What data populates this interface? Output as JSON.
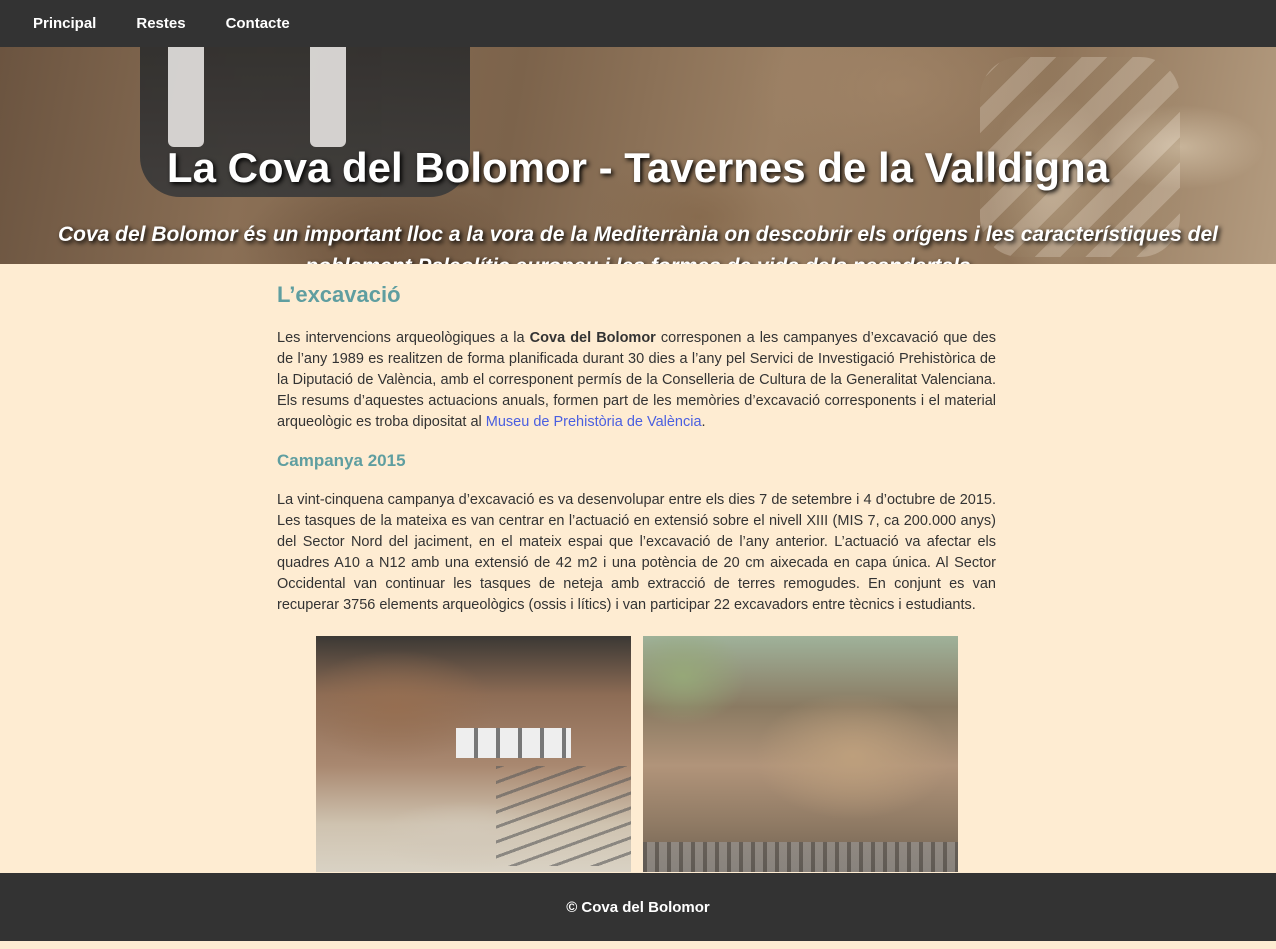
{
  "nav": {
    "items": [
      "Principal",
      "Restes",
      "Contacte"
    ]
  },
  "hero": {
    "title": "La Cova del Bolomor - Tavernes de la Valldigna",
    "subtitle": "Cova del Bolomor és un important lloc a la vora de la Mediterrània on descobrir els orígens i les característiques del poblament Paleolític europeu i les formes de vida dels neandertals"
  },
  "main": {
    "heading": "L’excavació",
    "intro": {
      "text_before": "Les intervencions arqueològiques a la ",
      "strong": "Cova del Bolomor",
      "text_middle": " corresponen a les campanyes d’excavació que des de l’any 1989 es realitzen de forma planificada durant 30 dies a l’any pel Servici de Investigació Prehistòrica de la Diputació de València, amb el corresponent permís de la Conselleria de Cultura de la Generalitat Valenciana. Els resums d’aquestes actuacions anuals, formen part de les memòries d’excavació corresponents i el material arqueològic es troba dipositat al ",
      "link": "Museu de Prehistòria de València",
      "text_after": "."
    },
    "subheading": "Campanya 2015",
    "campaign_text": "La vint-cinquena campanya d’excavació es va desenvolupar entre els dies 7 de setembre i 4 d’octubre de 2015. Les tasques de la mateixa es van centrar en l’actuació en extensió sobre el nivell XIII (MIS 7, ca 200.000 anys) del Sector Nord del jaciment, en el mateix espai que l’excavació de l’any anterior. L’actuació va afectar els quadres A10 a N12 amb una extensió de 42 m2 i una potència de 20 cm aixecada en capa única. Al Sector Occidental van continuar les tasques de neteja amb extracció de terres remogudes. En conjunt es van recuperar 3756 elements arqueològics (ossis i lítics) i van participar 22 excavadors entre tècnics i estudiants."
  },
  "footer": {
    "text": "© Cova del Bolomor"
  }
}
